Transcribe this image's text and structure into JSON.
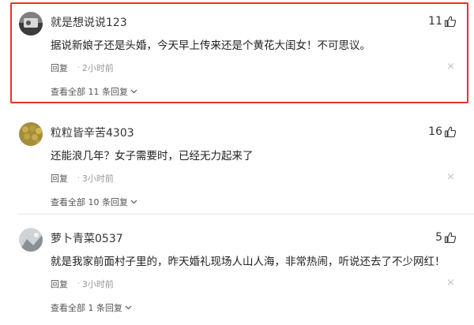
{
  "comments": [
    {
      "username": "就是想说说123",
      "likes": "11",
      "text": "据说新娘子还是头婚，今天早上传来还是个黄花大闺女！不可思议。",
      "reply_label": "回复",
      "dot": "·",
      "time": "2小时前",
      "close": "×",
      "view_all": "查看全部 11 条回复"
    },
    {
      "username": "粒粒皆辛苦4303",
      "likes": "16",
      "text": "还能浪几年？女子需要时，已经无力起来了",
      "reply_label": "回复",
      "dot": "·",
      "time": "3小时前",
      "close": "×",
      "view_all": "查看全部 10 条回复"
    },
    {
      "username": "萝卜青菜0537",
      "likes": "5",
      "text": "就是我家前面村子里的，昨天婚礼现场人山人海，非常热闹，听说还去了不少网红！",
      "reply_label": "回复",
      "dot": "·",
      "time": "3小时前",
      "close": "×",
      "view_all": "查看全部 1 条回复"
    }
  ],
  "colors": {
    "highlight_border": "#e8322b",
    "secondary_text": "#999999",
    "primary_text": "#222222"
  },
  "icons": {
    "like": "thumbs-up-icon",
    "close": "close-icon",
    "expand": "chevron-down-icon"
  }
}
